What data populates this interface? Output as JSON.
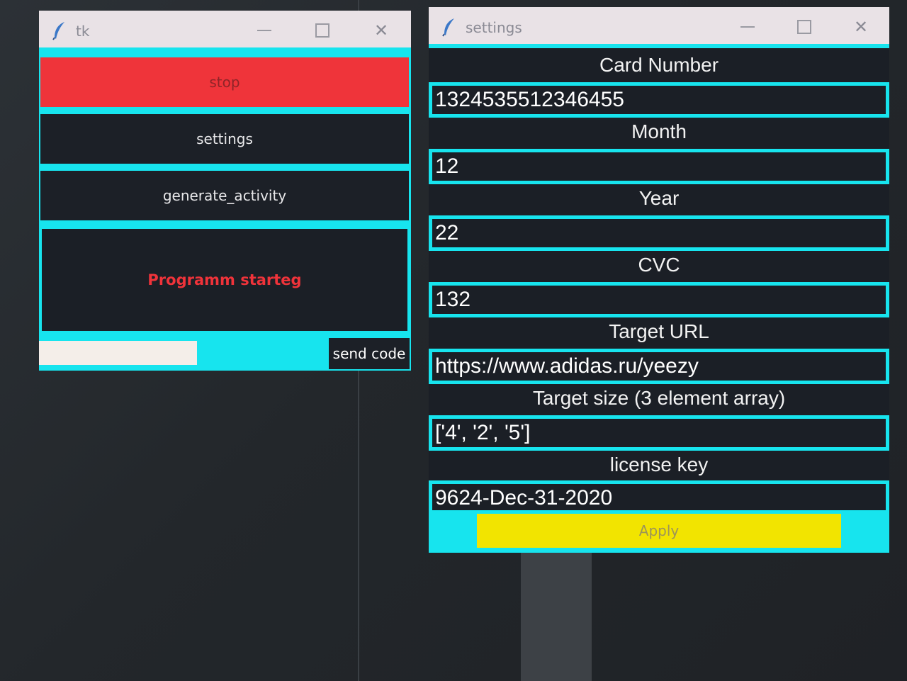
{
  "tk_window": {
    "title": "tk",
    "icon": "feather-icon",
    "stop_label": "stop",
    "settings_label": "settings",
    "generate_label": "generate_activity",
    "status_text": "Programm starteg",
    "code_input_value": "",
    "send_code_label": "send code"
  },
  "settings_window": {
    "title": "settings",
    "icon": "feather-icon",
    "fields": {
      "card_number": {
        "label": "Card Number",
        "value": "1324535512346455"
      },
      "month": {
        "label": "Month",
        "value": "12"
      },
      "year": {
        "label": "Year",
        "value": "22"
      },
      "cvc": {
        "label": "CVC",
        "value": "132"
      },
      "target_url": {
        "label": "Target URL",
        "value": "https://www.adidas.ru/yeezy"
      },
      "target_size": {
        "label": "Target size (3 element array)",
        "value": "['4', '2', '5']"
      },
      "license_key": {
        "label": "license key",
        "value": "9624-Dec-31-2020"
      }
    },
    "apply_label": "Apply"
  },
  "colors": {
    "accent_cyan": "#17e4ee",
    "stop_red": "#ef343a",
    "status_red": "#f0333a",
    "apply_yellow": "#f2e400",
    "panel_dark": "#1b1f26"
  }
}
